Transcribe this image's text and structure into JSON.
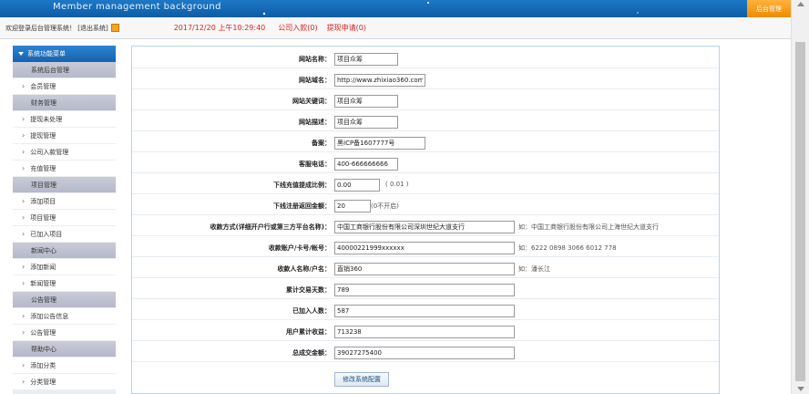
{
  "header": {
    "title": "Member management background",
    "admin_tab": "后台管理"
  },
  "status": {
    "welcome": "欢迎登录后台管理系统！ [退出系统]",
    "datetime": "2017/12/20 上午10:29:40",
    "incoming": "公司入款(0)",
    "withdraw": "提现申请(0)"
  },
  "sidebar": {
    "header": "系统功能菜单",
    "entries": [
      {
        "type": "cat",
        "label": "系统后台管理"
      },
      {
        "type": "item",
        "label": "会员管理"
      },
      {
        "type": "cat",
        "label": "财务管理"
      },
      {
        "type": "item",
        "label": "提现未处理"
      },
      {
        "type": "item",
        "label": "提现管理"
      },
      {
        "type": "item",
        "label": "公司入款管理"
      },
      {
        "type": "item",
        "label": "充值管理"
      },
      {
        "type": "cat",
        "label": "项目管理"
      },
      {
        "type": "item",
        "label": "添加项目"
      },
      {
        "type": "item",
        "label": "项目管理"
      },
      {
        "type": "item",
        "label": "已加入项目"
      },
      {
        "type": "cat",
        "label": "新闻中心"
      },
      {
        "type": "item",
        "label": "添加新闻"
      },
      {
        "type": "item",
        "label": "新闻管理"
      },
      {
        "type": "cat",
        "label": "公告管理"
      },
      {
        "type": "item",
        "label": "添加公告信息"
      },
      {
        "type": "item",
        "label": "公告管理"
      },
      {
        "type": "cat",
        "label": "帮助中心"
      },
      {
        "type": "item",
        "label": "添加分类"
      },
      {
        "type": "item",
        "label": "分类管理"
      }
    ]
  },
  "form": {
    "fields": [
      {
        "label": "网站名称：",
        "value": "项目众筹",
        "hint": ""
      },
      {
        "label": "网站域名：",
        "value": "http://www.zhixiao360.com",
        "hint": ""
      },
      {
        "label": "网站关键词：",
        "value": "项目众筹",
        "hint": ""
      },
      {
        "label": "网站描述：",
        "value": "项目众筹",
        "hint": ""
      },
      {
        "label": "备案：",
        "value": "黑ICP备1607777号",
        "hint": ""
      },
      {
        "label": "客服电话：",
        "value": "400-666666666",
        "hint": ""
      },
      {
        "label": "下线充值提成比例：",
        "value": "0.00",
        "hint": "( 0.01 )"
      },
      {
        "label": "下线注册返回金额：",
        "value": "20",
        "hint": "(0不开启)"
      },
      {
        "label": "收款方式(详细开户行或第三方平台名称)：",
        "value": "中国工商银行股份有限公司深圳世纪大道支行",
        "hint": "如：中国工商银行股份有限公司上海世纪大道支行"
      },
      {
        "label": "收款账户/卡号/帐号：",
        "value": "40000221999xxxxxx",
        "hint": "如：6222 0898 3066 6012 778"
      },
      {
        "label": "收款人名称/户名：",
        "value": "直销360",
        "hint": "如：潘长江"
      },
      {
        "label": "累计交易天数：",
        "value": "789",
        "hint": ""
      },
      {
        "label": "已加入人数：",
        "value": "587",
        "hint": ""
      },
      {
        "label": "用户累计收益：",
        "value": "713238",
        "hint": ""
      },
      {
        "label": "总成交金额：",
        "value": "39027275400",
        "hint": ""
      }
    ],
    "submit_label": "修改系统配置"
  },
  "colors": {
    "header_blue": "#1d78c6",
    "accent_orange": "#f08a00",
    "status_red": "#dd2222"
  }
}
